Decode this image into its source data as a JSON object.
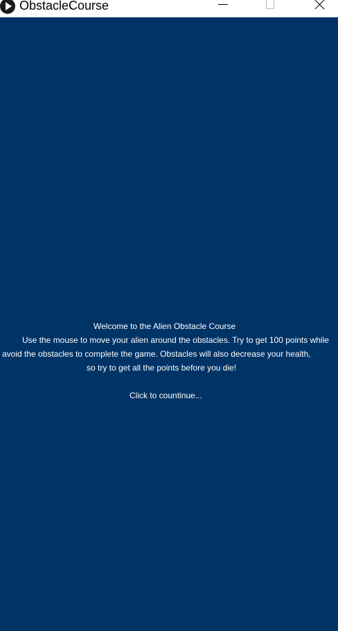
{
  "window": {
    "title": "ObstacleCourse",
    "icon": "processing-play-icon",
    "controls": {
      "minimize_icon": "minimize-icon",
      "maximize_icon": "maximize-icon",
      "close_icon": "close-icon"
    }
  },
  "canvas": {
    "background_color": "#003366",
    "text_color": "#ffffff",
    "intro": {
      "heading": "Welcome to the Alien Obstacle Course",
      "line1": "Use the mouse to move your alien around the obstacles. Try to get 100 points while",
      "line2": "avoid the obstacles to complete the game. Obstacles will also decrease your health,",
      "line3": "so try to get all the points before you die!",
      "prompt": "Click to countinue..."
    }
  }
}
